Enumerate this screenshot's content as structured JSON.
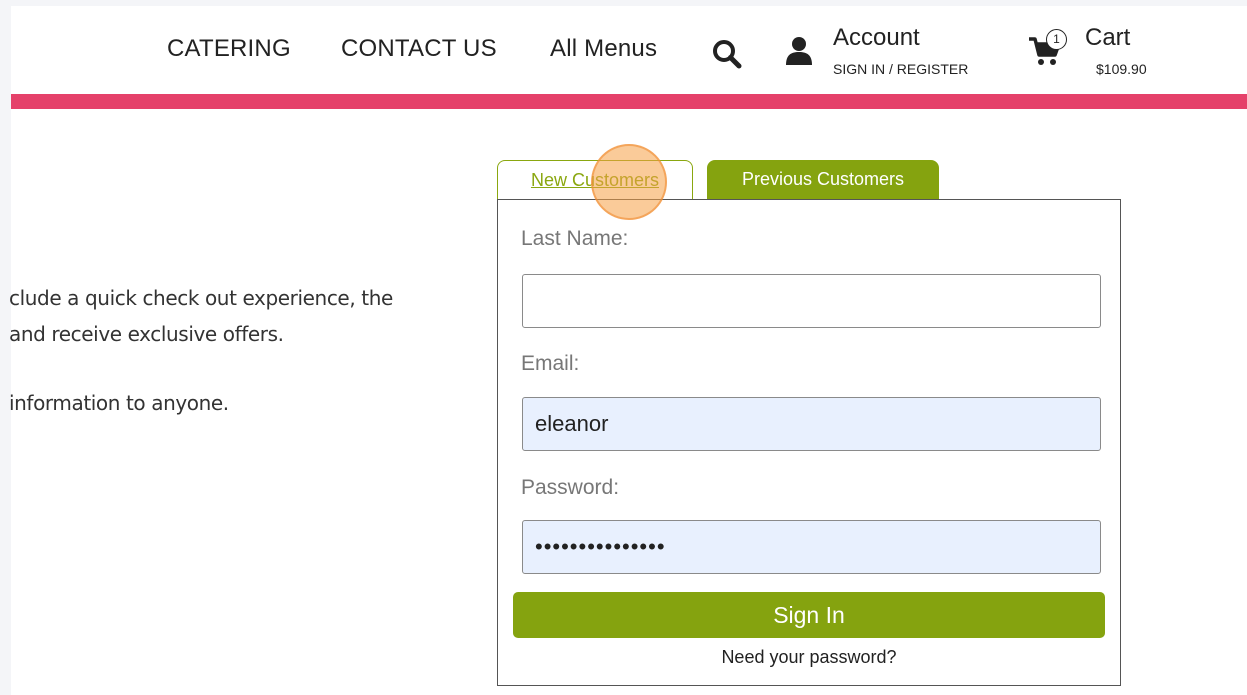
{
  "header": {
    "nav": [
      "CATERING",
      "CONTACT US",
      "All Menus"
    ],
    "search_icon": "search-icon",
    "account": {
      "icon": "user-icon",
      "title": "Account",
      "subtitle": "SIGN IN / REGISTER"
    },
    "cart": {
      "icon": "cart-icon",
      "count": "1",
      "title": "Cart",
      "total": "$109.90"
    }
  },
  "intro": {
    "line1": "clude a quick check out experience, the",
    "line2": "and receive exclusive offers.",
    "line3": "information to anyone."
  },
  "tabs": {
    "new_customers": "New Customers",
    "previous_customers": "Previous Customers"
  },
  "form": {
    "last_name_label": "Last Name:",
    "last_name_value": "",
    "email_label": "Email:",
    "email_value": "eleanor",
    "password_label": "Password:",
    "password_value": "•••••••••••••••",
    "sign_in": "Sign In",
    "forgot": "Need your password?"
  },
  "colors": {
    "accent_pink": "#e5416a",
    "accent_green": "#85a30f"
  }
}
